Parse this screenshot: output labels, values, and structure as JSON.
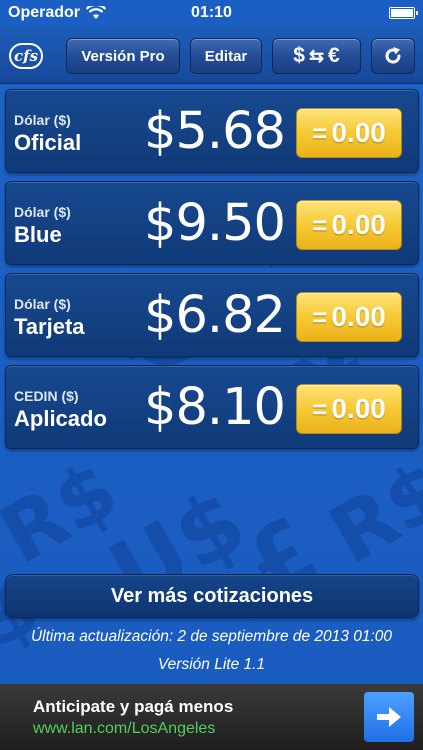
{
  "status_bar": {
    "carrier": "Operador",
    "time": "01:10"
  },
  "toolbar": {
    "pro_label": "Versión Pro",
    "edit_label": "Editar",
    "conv_left": "$",
    "conv_arrows": "⇆",
    "conv_right": "€"
  },
  "rows": [
    {
      "small": "Dólar ($)",
      "big": "Oficial",
      "price": "$5.68",
      "result": "0.00"
    },
    {
      "small": "Dólar ($)",
      "big": "Blue",
      "price": "$9.50",
      "result": "0.00"
    },
    {
      "small": "Dólar ($)",
      "big": "Tarjeta",
      "price": "$6.82",
      "result": "0.00"
    },
    {
      "small": "CEDIN ($)",
      "big": "Aplicado",
      "price": "$8.10",
      "result": "0.00"
    }
  ],
  "result_prefix": "=",
  "more_button": "Ver más cotizaciones",
  "updated": "Última actualización: 2 de septiembre de 2013 01:00",
  "version": "Versión Lite 1.1",
  "ad": {
    "title": "Anticipate y pagá menos",
    "url": "www.lan.com/LosAngeles"
  },
  "logo_text": "cfs",
  "colors": {
    "background": "#1b5fc4",
    "result_button": "#f6c934",
    "ad_url": "#4fd05a"
  }
}
